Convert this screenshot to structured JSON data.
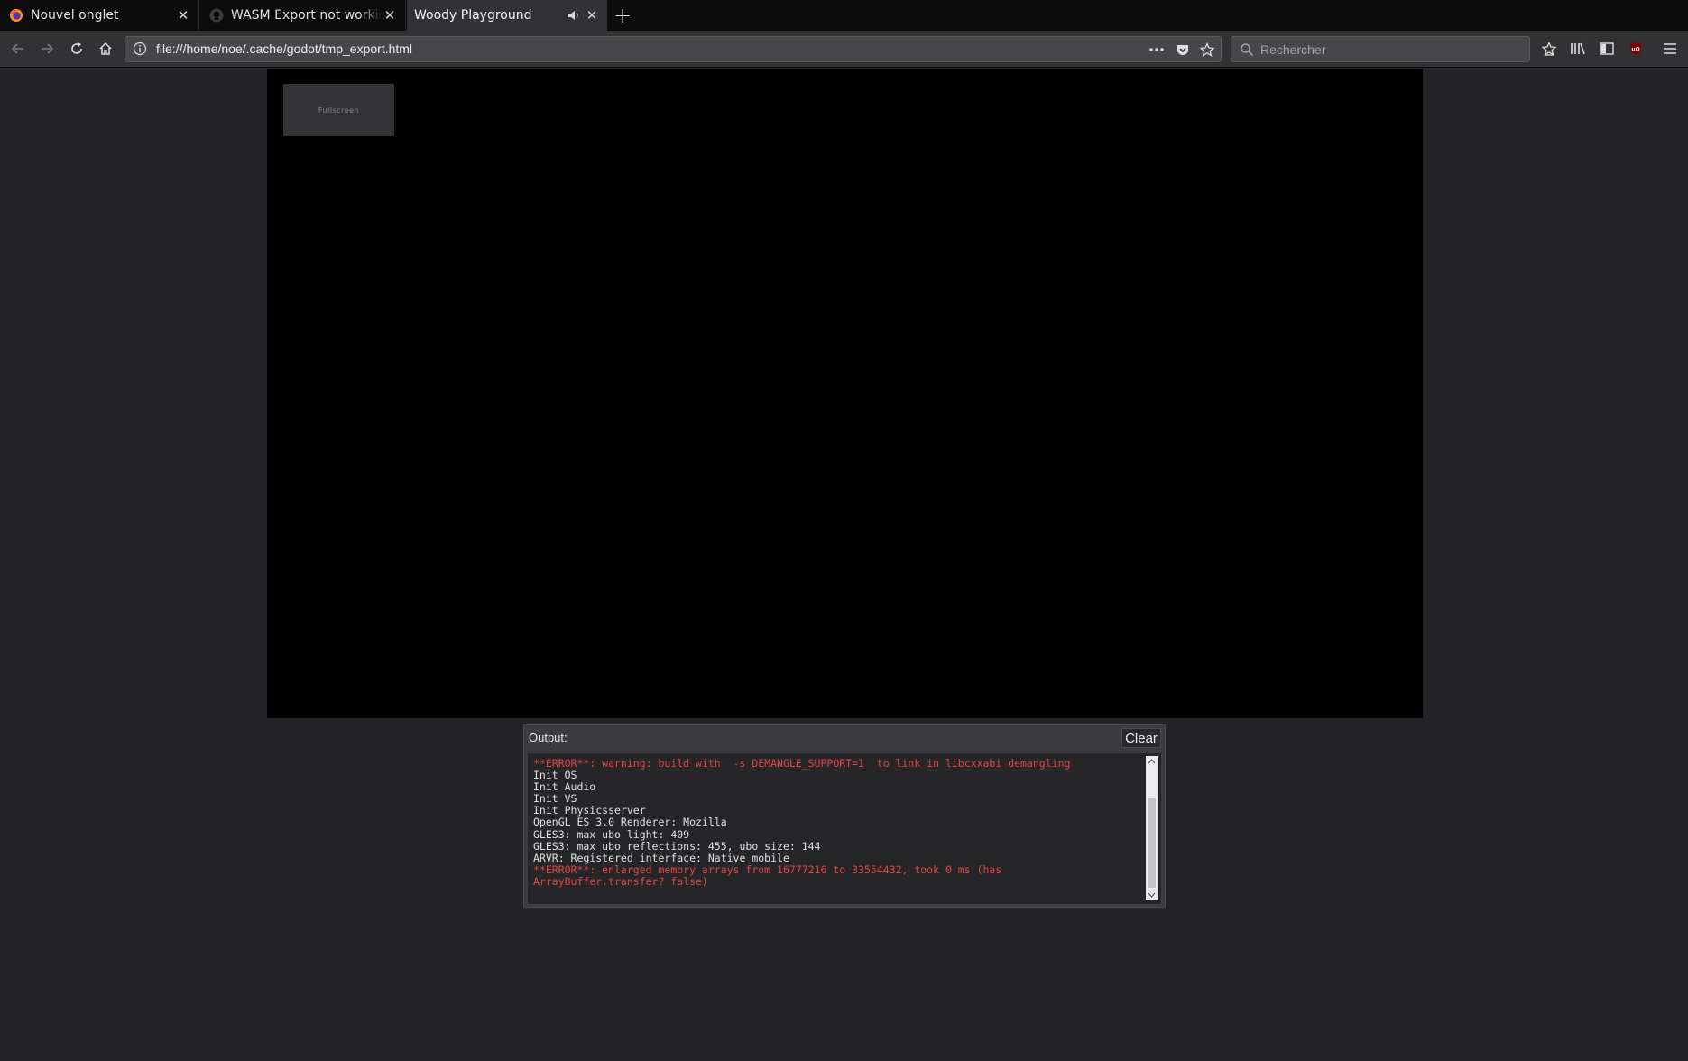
{
  "tabs": [
    {
      "label": "Nouvel onglet",
      "icon": "firefox-icon",
      "active": false
    },
    {
      "label": "WASM Export not working pr",
      "icon": "github-icon",
      "active": false
    },
    {
      "label": "Woody Playground",
      "icon": "",
      "active": true,
      "audio": "speaker-icon"
    }
  ],
  "navbar": {
    "url": "file:///home/noe/.cache/godot/tmp_export.html",
    "search_placeholder": "Rechercher",
    "icons": [
      "back-icon",
      "forward-icon",
      "reload-icon",
      "home-icon",
      "info-icon",
      "page-actions-icon",
      "pocket-icon",
      "bookmark-star-icon",
      "search-icon",
      "downloads-icon",
      "library-icon",
      "sidebar-icon",
      "ublock-icon",
      "menu-icon"
    ]
  },
  "game": {
    "fullscreen_label": "Fullscreen"
  },
  "output": {
    "title": "Output:",
    "clear_label": "Clear",
    "lines": [
      {
        "text": "**ERROR**: warning: build with  -s DEMANGLE_SUPPORT=1  to link in libcxxabi demangling",
        "level": "error"
      },
      {
        "text": "Init OS",
        "level": "info"
      },
      {
        "text": "Init Audio",
        "level": "info"
      },
      {
        "text": "Init VS",
        "level": "info"
      },
      {
        "text": "Init Physicsserver",
        "level": "info"
      },
      {
        "text": "OpenGL ES 3.0 Renderer: Mozilla",
        "level": "info"
      },
      {
        "text": "GLES3: max ubo light: 409",
        "level": "info"
      },
      {
        "text": "GLES3: max ubo reflections: 455, ubo size: 144",
        "level": "info"
      },
      {
        "text": "ARVR: Registered interface: Native mobile",
        "level": "info"
      },
      {
        "text": "**ERROR**: enlarged memory arrays from 16777216 to 33554432, took 0 ms (has ArrayBuffer.transfer? false)",
        "level": "error"
      }
    ]
  },
  "colors": {
    "page_bg": "#232328",
    "error_text": "#e04848",
    "log_text": "#e2e2e4"
  }
}
